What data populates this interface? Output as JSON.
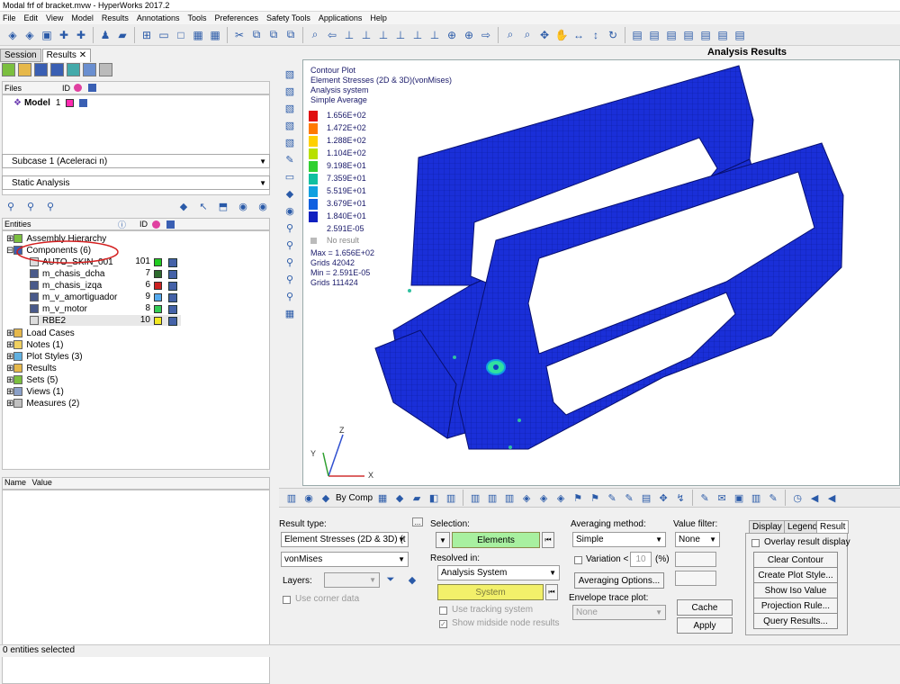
{
  "window": {
    "title": "Modal frf of bracket.mvw - HyperWorks 2017.2"
  },
  "menu": [
    "File",
    "Edit",
    "View",
    "Model",
    "Results",
    "Annotations",
    "Tools",
    "Preferences",
    "Safety Tools",
    "Applications",
    "Help"
  ],
  "left": {
    "tabs": [
      "Session",
      "Results"
    ],
    "files_header": "Files",
    "id_header": "ID",
    "model_label": "Model",
    "model_id": "1",
    "subcase": "Subcase 1 (Aceleraci  n)",
    "analysis": "Static Analysis",
    "entities_header": "Entities",
    "ent_id_header": "ID",
    "tree": [
      {
        "label": "Assembly Hierarchy"
      },
      {
        "label": "Components (6)"
      },
      {
        "label": "AUTO_SKIN_001",
        "id": "101",
        "color": "#22cc22"
      },
      {
        "label": "m_chasis_dcha",
        "id": "7",
        "color": "#2e6b2e"
      },
      {
        "label": "m_chasis_izqa",
        "id": "6",
        "color": "#cc2222"
      },
      {
        "label": "m_v_amortiguador",
        "id": "9",
        "color": "#55aaee"
      },
      {
        "label": "m_v_motor",
        "id": "8",
        "color": "#33cc55"
      },
      {
        "label": "RBE2",
        "id": "10",
        "color": "#f2e822"
      },
      {
        "label": "Load Cases"
      },
      {
        "label": "Notes (1)"
      },
      {
        "label": "Plot Styles (3)"
      },
      {
        "label": "Results"
      },
      {
        "label": "Sets (5)"
      },
      {
        "label": "Views (1)"
      },
      {
        "label": "Measures (2)"
      }
    ],
    "name_header": "Name",
    "value_header": "Value"
  },
  "status": "0 entities selected",
  "view": {
    "heading": "Analysis Results",
    "legend_lines": [
      "Contour Plot",
      "Element Stresses (2D & 3D)(vonMises)",
      "Analysis system",
      "Simple Average"
    ],
    "legend_values": [
      "1.656E+02",
      "1.472E+02",
      "1.288E+02",
      "1.104E+02",
      "9.198E+01",
      "7.359E+01",
      "5.519E+01",
      "3.679E+01",
      "1.840E+01",
      "2.591E-05"
    ],
    "legend_colors": [
      "#e01010",
      "#ff7a00",
      "#ffd000",
      "#b8e000",
      "#30d030",
      "#10c0a0",
      "#10a0e0",
      "#1060e0",
      "#1020c0",
      "#1010a0"
    ],
    "no_result": "No result",
    "stats": [
      "Max = 1.656E+02",
      "Grids 42042",
      "Min = 2.591E-05",
      "Grids 111424"
    ],
    "axes": {
      "x": "X",
      "y": "Y",
      "z": "Z"
    }
  },
  "bottom_toolbar": {
    "bycomp": "By Comp"
  },
  "panel": {
    "result_type_label": "Result type:",
    "result_type": "Element Stresses (2D & 3D) (t",
    "component": "vonMises",
    "layers_label": "Layers:",
    "use_corner": "Use corner data",
    "selection_label": "Selection:",
    "elements_btn": "Elements",
    "resolved_label": "Resolved in:",
    "resolved": "Analysis System",
    "system_btn": "System",
    "use_tracking": "Use tracking system",
    "show_midside": "Show midside node results",
    "averaging_label": "Averaging method:",
    "averaging": "Simple",
    "variation_label": "Variation <",
    "variation_val": "10",
    "pct": "(%)",
    "averaging_options": "Averaging Options...",
    "envelope_label": "Envelope trace plot:",
    "envelope": "None",
    "value_filter_label": "Value filter:",
    "value_filter": "None",
    "cache_btn": "Cache",
    "apply_btn": "Apply",
    "right_tabs": [
      "Display",
      "Legend",
      "Result"
    ],
    "overlay": "Overlay result display",
    "buttons": [
      "Clear Contour",
      "Create Plot Style...",
      "Show Iso Value",
      "Projection Rule...",
      "Query Results..."
    ]
  }
}
